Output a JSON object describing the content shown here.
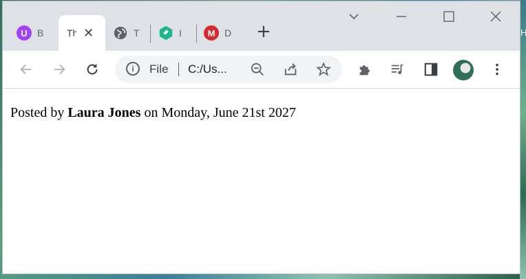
{
  "browser": {
    "tabs": [
      {
        "title": "B",
        "icon": "ublock-icon",
        "color": "#a142f4"
      },
      {
        "title": "Th",
        "active": true
      },
      {
        "title": "T",
        "icon": "globe-icon",
        "color": "#5f6368"
      },
      {
        "title": "I",
        "icon": "extension-brand-icon",
        "color": "#1fb48f"
      },
      {
        "title": "D",
        "icon": "mega-icon",
        "color": "#d9272e"
      }
    ],
    "address": {
      "scheme_label": "File",
      "url": "C:/Us..."
    }
  },
  "desktop": {
    "edge_letter": "H"
  },
  "page": {
    "prefix": "Posted by",
    "author": "Laura Jones",
    "middle": "on",
    "date": "Monday, June 21st 2027"
  }
}
